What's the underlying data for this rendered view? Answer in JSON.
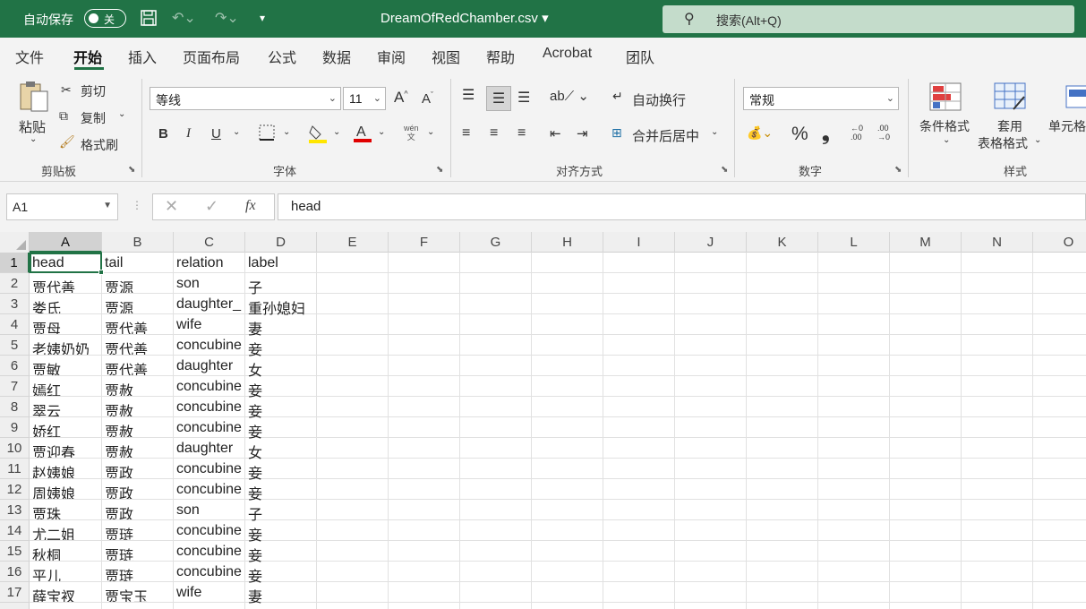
{
  "titlebar": {
    "autosave_label": "自动保存",
    "autosave_state": "关",
    "doc_title": "DreamOfRedChamber.csv",
    "search_placeholder": "搜索(Alt+Q)"
  },
  "tabs": [
    "文件",
    "开始",
    "插入",
    "页面布局",
    "公式",
    "数据",
    "审阅",
    "视图",
    "帮助",
    "Acrobat",
    "团队"
  ],
  "active_tab": "开始",
  "ribbon": {
    "clipboard": {
      "group": "剪贴板",
      "paste": "粘贴",
      "cut": "剪切",
      "copy": "复制",
      "format_painter": "格式刷"
    },
    "font": {
      "group": "字体",
      "font_name": "等线",
      "font_size": "11",
      "bold": "B",
      "italic": "I",
      "underline": "U",
      "phonetic": "wén",
      "phonetic_sub": "文"
    },
    "alignment": {
      "group": "对齐方式",
      "wrap_text": "自动换行",
      "merge_center": "合并后居中"
    },
    "number": {
      "group": "数字",
      "format": "常规",
      "percent": "%",
      "comma": "❟",
      "inc_decimal": "←0 .00",
      "dec_decimal": ".00 →0"
    },
    "styles": {
      "group": "样式",
      "conditional": "条件格式",
      "table_format_1": "套用",
      "table_format_2": "表格格式",
      "cell_styles": "单元格"
    }
  },
  "formula_bar": {
    "name_box": "A1",
    "fx": "fx",
    "value": "head"
  },
  "columns": [
    "A",
    "B",
    "C",
    "D",
    "E",
    "F",
    "G",
    "H",
    "I",
    "J",
    "K",
    "L",
    "M",
    "N",
    "O"
  ],
  "rows": [
    {
      "n": "1",
      "cells": [
        "head",
        "tail",
        "relation",
        "label"
      ]
    },
    {
      "n": "2",
      "cells": [
        "贾代善",
        "贾源",
        "son",
        "子"
      ]
    },
    {
      "n": "3",
      "cells": [
        "娄氏",
        "贾源",
        "daughter_",
        "重孙媳妇"
      ]
    },
    {
      "n": "4",
      "cells": [
        "贾母",
        "贾代善",
        "wife",
        "妻"
      ]
    },
    {
      "n": "5",
      "cells": [
        "老姨奶奶",
        "贾代善",
        "concubine",
        "妾"
      ]
    },
    {
      "n": "6",
      "cells": [
        "贾敏",
        "贾代善",
        "daughter",
        "女"
      ]
    },
    {
      "n": "7",
      "cells": [
        "嫣红",
        "贾赦",
        "concubine",
        "妾"
      ]
    },
    {
      "n": "8",
      "cells": [
        "翠云",
        "贾赦",
        "concubine",
        "妾"
      ]
    },
    {
      "n": "9",
      "cells": [
        "娇红",
        "贾赦",
        "concubine",
        "妾"
      ]
    },
    {
      "n": "10",
      "cells": [
        "贾迎春",
        "贾赦",
        "daughter",
        "女"
      ]
    },
    {
      "n": "11",
      "cells": [
        "赵姨娘",
        "贾政",
        "concubine",
        "妾"
      ]
    },
    {
      "n": "12",
      "cells": [
        "周姨娘",
        "贾政",
        "concubine",
        "妾"
      ]
    },
    {
      "n": "13",
      "cells": [
        "贾珠",
        "贾政",
        "son",
        "子"
      ]
    },
    {
      "n": "14",
      "cells": [
        "尤二姐",
        "贾琏",
        "concubine",
        "妾"
      ]
    },
    {
      "n": "15",
      "cells": [
        "秋桐",
        "贾琏",
        "concubine",
        "妾"
      ]
    },
    {
      "n": "16",
      "cells": [
        "平儿",
        "贾琏",
        "concubine",
        "妾"
      ]
    },
    {
      "n": "17",
      "cells": [
        "薛宝衩",
        "贾宝玉",
        "wife",
        "妻"
      ]
    }
  ],
  "colors": {
    "accent": "#217346",
    "search_bg": "#c4dccb",
    "ribbon_bg": "#f3f3f3"
  }
}
